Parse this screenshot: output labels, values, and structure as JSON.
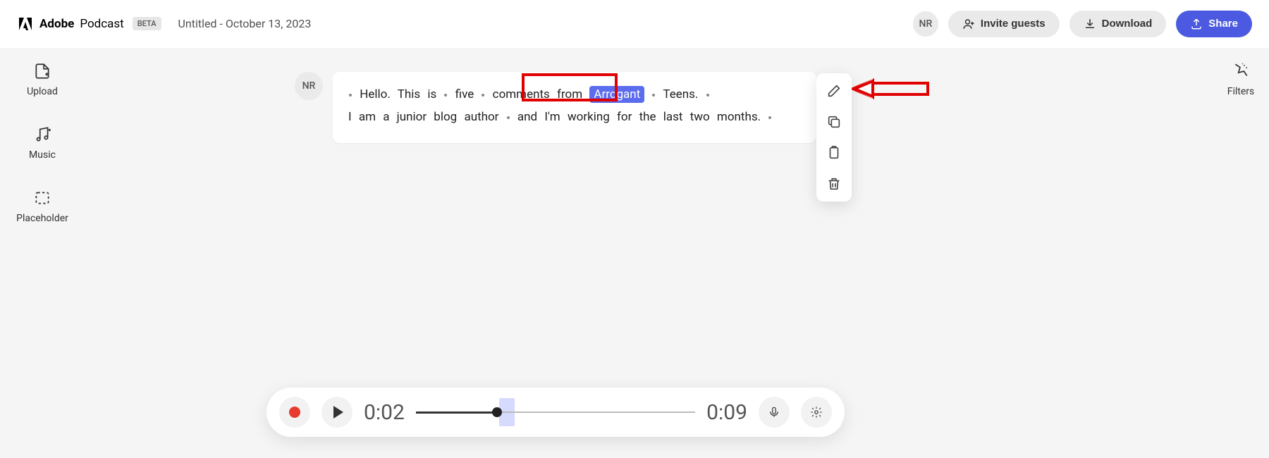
{
  "header": {
    "brand_adobe": "Adobe",
    "brand_podcast": "Podcast",
    "beta": "BETA",
    "title": "Untitled - October 13, 2023",
    "user_initials": "NR",
    "invite_label": "Invite guests",
    "download_label": "Download",
    "share_label": "Share"
  },
  "left_tools": {
    "upload": "Upload",
    "music": "Music",
    "placeholder": "Placeholder"
  },
  "right_tools": {
    "filters": "Filters"
  },
  "transcript": {
    "speaker_initials": "NR",
    "line1_pre": "Hello.  This  is",
    "line1_mid": "five",
    "line1_mid2": "comments  from",
    "line1_selected": "Arrogant",
    "line1_post": "Teens.",
    "line2_pre": "I  am  a  junior  blog  author",
    "line2_mid": "and  I'm  working  for  the  last  two  months."
  },
  "player": {
    "current_time": "0:02",
    "total_time": "0:09"
  }
}
